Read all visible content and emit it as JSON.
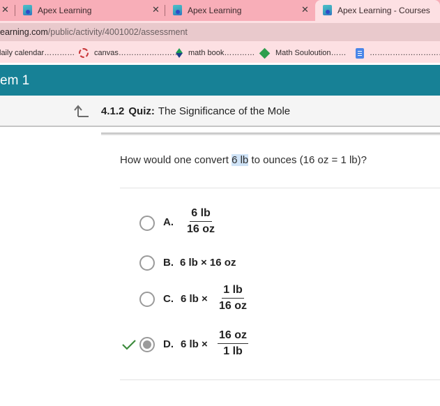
{
  "browser": {
    "tabs": [
      {
        "title": "Apex Learning",
        "active": false
      },
      {
        "title": "Apex Learning",
        "active": false
      },
      {
        "title": "Apex Learning - Courses",
        "active": true
      }
    ],
    "url": {
      "host": "earning.com",
      "path": "/public/activity/4001002/assessment"
    },
    "bookmarks": [
      {
        "label": "laily calendar…………",
        "icon": "none"
      },
      {
        "label": "canvas……………………",
        "icon": "canvas-ring-icon"
      },
      {
        "label": "math book…………",
        "icon": "math-book-icon"
      },
      {
        "label": "Math Souloution……",
        "icon": "diamond-icon"
      },
      {
        "label": "…………………………………",
        "icon": "google-docs-icon"
      }
    ]
  },
  "app": {
    "header_title": "em 1",
    "breadcrumb": {
      "number": "4.1.2",
      "type": "Quiz:",
      "title": "The Significance of the Mole"
    }
  },
  "question": {
    "before": "How would one convert ",
    "highlight": "6 lb",
    "after": " to ounces (16 oz = 1 lb)?"
  },
  "options": [
    {
      "letter": "A.",
      "prefix": "",
      "numerator": "6 lb",
      "denominator": "16 oz",
      "selected": false,
      "correct": false
    },
    {
      "letter": "B.",
      "text": "6 lb × 16 oz",
      "selected": false,
      "correct": false
    },
    {
      "letter": "C.",
      "prefix": "6 lb ×",
      "numerator": "1 lb",
      "denominator": "16 oz",
      "selected": false,
      "correct": false
    },
    {
      "letter": "D.",
      "prefix": "6 lb ×",
      "numerator": "16 oz",
      "denominator": "1 lb",
      "selected": true,
      "correct": true
    }
  ],
  "colors": {
    "header": "#178196",
    "tabstrip": "#f8aeb8",
    "check": "#3d8b3d",
    "highlight": "#cfe3f7"
  }
}
